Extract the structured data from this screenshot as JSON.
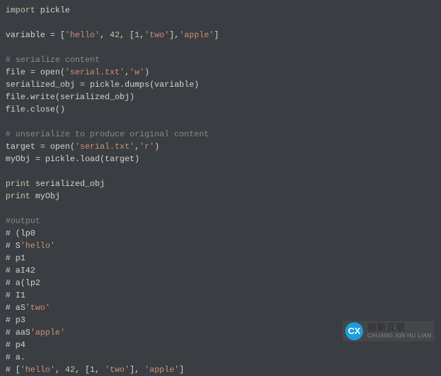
{
  "code": {
    "l1_import": "import",
    "l1_pickle": " pickle",
    "l3_var": "variable = [",
    "l3_s1": "'hello'",
    "l3_c1": ", ",
    "l3_n1": "42",
    "l3_c2": ", [",
    "l3_n2": "1",
    "l3_c3": ",",
    "l3_s2": "'two'",
    "l3_c4": "],",
    "l3_s3": "'apple'",
    "l3_c5": "]",
    "l5_comment": "# serialize content",
    "l6": "file = open(",
    "l6_s1": "'serial.txt'",
    "l6_c1": ",",
    "l6_s2": "'w'",
    "l6_c2": ")",
    "l7": "serialized_obj = pickle.dumps(variable)",
    "l8": "file.write(serialized_obj)",
    "l9": "file.close()",
    "l11_comment": "# unserialize to produce original content",
    "l12": "target = open(",
    "l12_s1": "'serial.txt'",
    "l12_c1": ",",
    "l12_s2": "'r'",
    "l12_c2": ")",
    "l13": "myObj = pickle.load(target)",
    "l15_print": "print",
    "l15_rest": " serialized_obj",
    "l16_print": "print",
    "l16_rest": " myObj",
    "l18_output": "#output",
    "l19": "# (lp0",
    "l20a": "# S",
    "l20b": "'hello'",
    "l21": "# p1",
    "l22": "# aI42",
    "l23": "# a(lp2",
    "l24": "# I1",
    "l25a": "# aS",
    "l25b": "'two'",
    "l26": "# p3",
    "l27a": "# aaS",
    "l27b": "'apple'",
    "l28": "# p4",
    "l29": "# a.",
    "l30a": "# [",
    "l30_s1": "'hello'",
    "l30_c1": ", ",
    "l30_n1": "42",
    "l30_c2": ", [",
    "l30_n2": "1",
    "l30_c3": ", ",
    "l30_s2": "'two'",
    "l30_c4": "], ",
    "l30_s3": "'apple'",
    "l30_c5": "]"
  },
  "logo": {
    "icon": "CX",
    "cn": "创新互联",
    "en": "CHUANG XIN HU LIAN"
  }
}
